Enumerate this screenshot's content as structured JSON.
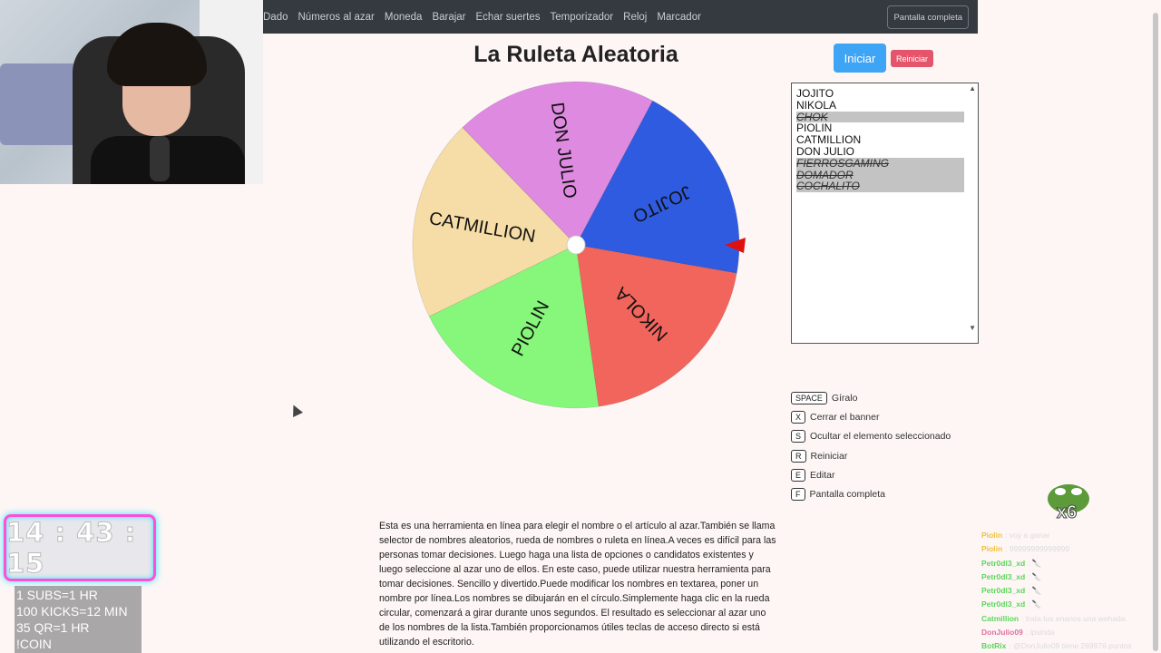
{
  "nav": {
    "items": [
      "Dado",
      "Números al azar",
      "Moneda",
      "Barajar",
      "Echar suertes",
      "Temporizador",
      "Reloj",
      "Marcador"
    ],
    "fullscreen_label": "Pantalla completa"
  },
  "title": "La Ruleta Aleatoria",
  "buttons": {
    "start": "Iniciar",
    "reset": "Reiniciar"
  },
  "wheel": {
    "segments": [
      {
        "label": "JOJITO",
        "color": "#2f5be0"
      },
      {
        "label": "NIKOLA",
        "color": "#f2655d"
      },
      {
        "label": "PIOLIN",
        "color": "#86f77a"
      },
      {
        "label": "CATMILLION",
        "color": "#f6dca6"
      },
      {
        "label": "DON JULIO",
        "color": "#dd8ae0"
      }
    ],
    "pointer_color": "#e01010"
  },
  "names": [
    {
      "text": "JOJITO",
      "hidden": false
    },
    {
      "text": "NIKOLA",
      "hidden": false
    },
    {
      "text": "CHOK",
      "hidden": true
    },
    {
      "text": "PIOLIN",
      "hidden": false
    },
    {
      "text": "CATMILLION",
      "hidden": false
    },
    {
      "text": "DON JULIO",
      "hidden": false
    },
    {
      "text": "FIERROSGAMING",
      "hidden": true
    },
    {
      "text": "DOMADOR ",
      "hidden": true
    },
    {
      "text": "COCHALITO",
      "hidden": true
    }
  ],
  "shortcuts": [
    {
      "key": "SPACE",
      "label": "Gíralo"
    },
    {
      "key": "X",
      "label": "Cerrar el banner"
    },
    {
      "key": "S",
      "label": "Ocultar el elemento seleccionado"
    },
    {
      "key": "R",
      "label": "Reiniciar"
    },
    {
      "key": "E",
      "label": "Editar"
    },
    {
      "key": "F",
      "label": "Pantalla completa"
    }
  ],
  "description": "Esta es una herramienta en línea para elegir el nombre o el artículo al azar.También se llama selector de nombres aleatorios, rueda de nombres o ruleta en línea.A veces es difícil para las personas tomar decisiones. Luego haga una lista de opciones o candidatos existentes y luego seleccione al azar uno de ellos. En este caso, puede utilizar nuestra herramienta para tomar decisiones. Sencillo y divertido.Puede modificar los nombres en textarea, poner un nombre por línea.Los nombres se dibujarán en el círculo.Simplemente haga clic en la rueda circular, comenzará a girar durante unos segundos. El resultado es seleccionar al azar uno de los nombres de la lista.También proporcionamos útiles teclas de acceso directo si está utilizando el escritorio.",
  "overlay": {
    "timer": "14 : 43 : 15",
    "subs_lines": [
      "1 SUBS=1 HR",
      "100 KICKS=12 MIN",
      "35 QR=1 HR",
      "!COIN"
    ],
    "emote_multiplier": "x6",
    "chat": [
      {
        "user": "Piolin",
        "color": "#f0c040",
        "text": ": voy a ganar"
      },
      {
        "user": "Piolin",
        "color": "#f0c040",
        "text": ": 99999999999999"
      },
      {
        "user": "Petr0dl3_xd",
        "color": "#5cd65c",
        "text": ": 🔪"
      },
      {
        "user": "Petr0dl3_xd",
        "color": "#5cd65c",
        "text": ": 🔪"
      },
      {
        "user": "Petr0dl3_xd",
        "color": "#5cd65c",
        "text": ": 🔪"
      },
      {
        "user": "Petr0dl3_xd",
        "color": "#5cd65c",
        "text": ": 🔪"
      },
      {
        "user": "Catmillion",
        "color": "#5cd65c",
        "text": ": trata tus enanos una wehada."
      },
      {
        "user": "DonJulio09",
        "color": "#e070a0",
        "text": ": lpsinda"
      },
      {
        "user": "BotRix",
        "color": "#5cd65c",
        "text": ": @DonJulio09 tiene 269976 puntos"
      }
    ]
  }
}
